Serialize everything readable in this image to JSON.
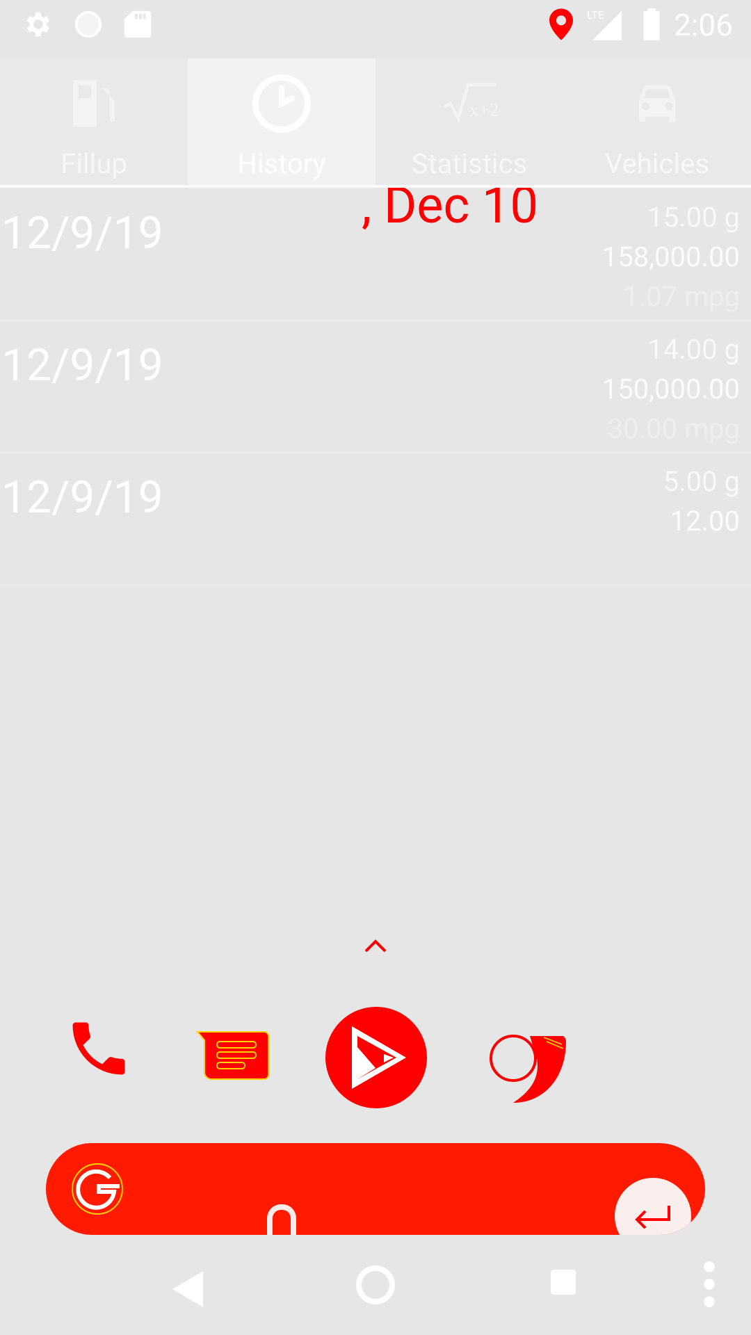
{
  "status_bar": {
    "time": "2:06",
    "icons": [
      "gear-icon",
      "circle-icon",
      "sd-card-icon",
      "location-icon",
      "lte-signal-icon",
      "battery-icon"
    ],
    "network_label": "LTE"
  },
  "tabs": [
    {
      "label": "Fillup",
      "icon": "fuel-pump-icon",
      "active": false
    },
    {
      "label": "History",
      "icon": "clock-icon",
      "active": true
    },
    {
      "label": "Statistics",
      "icon": "sqrt-icon",
      "active": false
    },
    {
      "label": "Vehicles",
      "icon": "car-icon",
      "active": false
    }
  ],
  "date_overlay": ", Dec 10",
  "history": [
    {
      "date": "12/9/19",
      "gallons": "15.00 g",
      "odometer": "158,000.00",
      "mpg": "1.07 mpg"
    },
    {
      "date": "12/9/19",
      "gallons": "14.00 g",
      "odometer": "150,000.00",
      "mpg": "30.00 mpg"
    },
    {
      "date": "12/9/19",
      "gallons": "5.00 g",
      "odometer": "12.00",
      "mpg": ""
    }
  ],
  "dock": {
    "apps": [
      "phone-icon",
      "messages-icon",
      "play-store-icon",
      "chrome-icon"
    ]
  },
  "colors": {
    "accent": "#ff0000",
    "background": "#e6e6e6",
    "text_light": "#ffffff"
  }
}
